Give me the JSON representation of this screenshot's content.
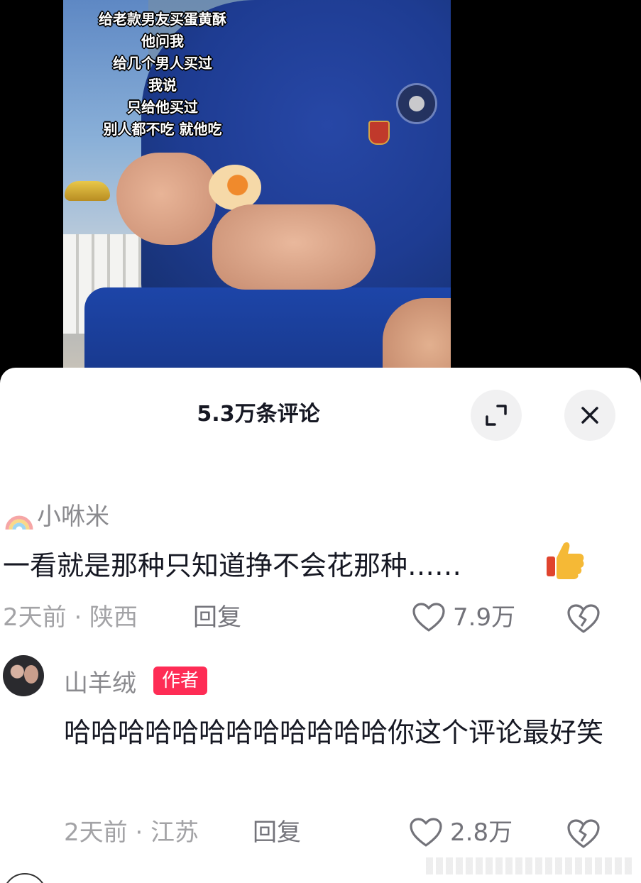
{
  "video": {
    "caption_lines": [
      "给老款男友买蛋黄酥",
      "他问我",
      "给几个男人买过",
      "我说",
      "只给他买过",
      "别人都不吃 就他吃"
    ]
  },
  "sheet": {
    "title": "5.3万条评论",
    "expand_icon": "expand-icon",
    "close_icon": "close-icon"
  },
  "comments": [
    {
      "username": "小咻米",
      "username_prefix_icon": "rainbow-icon",
      "text": "一看就是那种只知道挣不会花那种……",
      "emoji_icon": "thumbs-up-icon",
      "time_location": "2天前 · 陕西",
      "reply_label": "回复",
      "likes": "7.9万"
    },
    {
      "username": "山羊绒",
      "author_tag": "作者",
      "text": "哈哈哈哈哈哈哈哈哈哈哈哈你这个评论最好笑",
      "time_location": "2天前 · 江苏",
      "reply_label": "回复",
      "likes": "2.8万"
    }
  ],
  "colors": {
    "author_tag_bg": "#fe2c55",
    "text_primary": "#161823",
    "text_secondary": "#a3a3a6",
    "sheet_bg": "#ffffff",
    "button_bg": "#f1f1f2"
  }
}
